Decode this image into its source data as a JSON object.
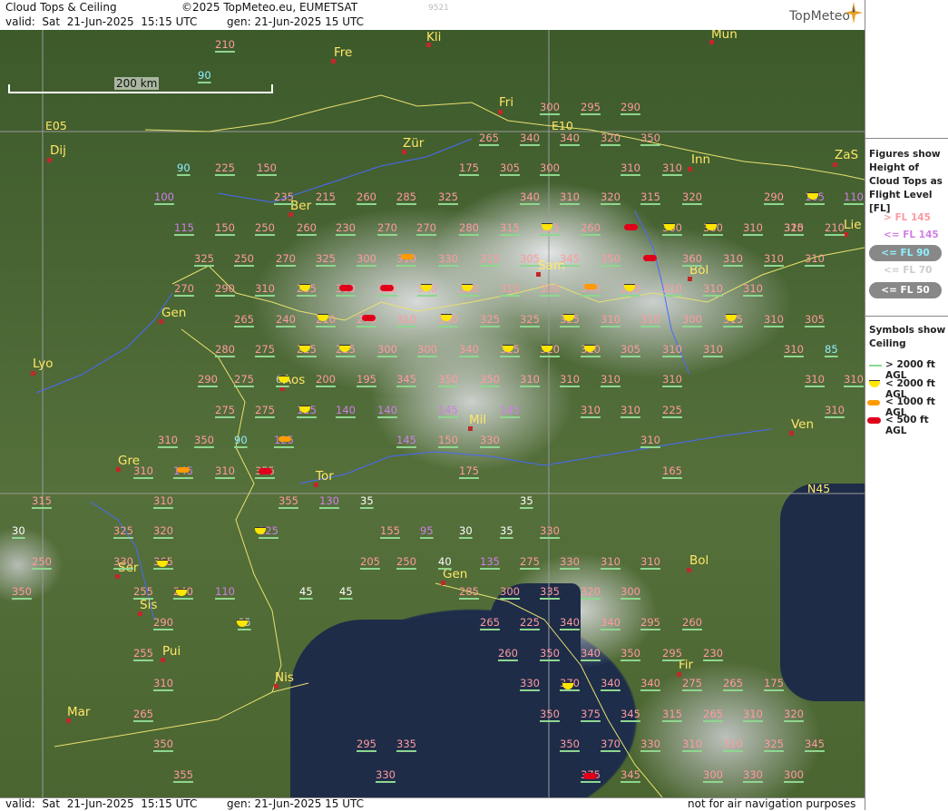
{
  "header": {
    "title": "Cloud Tops & Ceiling",
    "copyright": "©2025 TopMeteo.eu, EUMETSAT",
    "valid": "valid:  Sat  21-Jun-2025  15:15 UTC",
    "gen": "gen: 21-Jun-2025 15 UTC",
    "id": "9521",
    "logo": "TopMeteo"
  },
  "footer": {
    "valid": "valid:  Sat  21-Jun-2025  15:15 UTC",
    "gen": "gen: 21-Jun-2025 15 UTC",
    "disclaimer": "not for air navigation purposes"
  },
  "scale": {
    "label": "200 km"
  },
  "legend": {
    "figures_title": "Figures show Height of Cloud Tops as Flight Level  [FL]",
    "figures": [
      {
        "label": "> FL 145",
        "color": "#ff9aa0"
      },
      {
        "label": "<= FL 145",
        "color": "#d07ee8"
      },
      {
        "label": "<= FL 90",
        "color": "#8ff0ff"
      },
      {
        "label": "<= FL 70",
        "color": "#cccccc"
      },
      {
        "label": "<= FL 50",
        "color": "#ffffff"
      }
    ],
    "symbols_title": "Symbols show Ceiling",
    "symbols": [
      {
        "label": "> 2000 ft AGL",
        "color": "#8fd68f"
      },
      {
        "label": "< 2000 ft AGL",
        "color": "#ffe600"
      },
      {
        "label": "< 1000 ft AGL",
        "color": "#ff9a00"
      },
      {
        "label": "< 500 ft AGL",
        "color": "#e0001a"
      }
    ]
  },
  "cities": [
    {
      "name": "Fre"
    },
    {
      "name": "Kli"
    },
    {
      "name": "Mun"
    },
    {
      "name": "Dij"
    },
    {
      "name": "Zür"
    },
    {
      "name": "Fri"
    },
    {
      "name": "Inn"
    },
    {
      "name": "ZaS"
    },
    {
      "name": "Lie"
    },
    {
      "name": "Ber"
    },
    {
      "name": "Sam"
    },
    {
      "name": "Bol"
    },
    {
      "name": "Gen"
    },
    {
      "name": "Lyo"
    },
    {
      "name": "Aos"
    },
    {
      "name": "Mil"
    },
    {
      "name": "Ven"
    },
    {
      "name": "Gre"
    },
    {
      "name": "Tor"
    },
    {
      "name": "Ser"
    },
    {
      "name": "Gen"
    },
    {
      "name": "Bol"
    },
    {
      "name": "Sis"
    },
    {
      "name": "Pui"
    },
    {
      "name": "Nis"
    },
    {
      "name": "Fir"
    },
    {
      "name": "Mar"
    }
  ],
  "grid_labels": [
    "E05",
    "E10",
    "N45"
  ],
  "flight_levels": [
    "210",
    "90",
    "225",
    "150",
    "90",
    "100",
    "235",
    "215",
    "260",
    "285",
    "325",
    "175",
    "305",
    "300",
    "300",
    "295",
    "290",
    "265",
    "340",
    "340",
    "320",
    "350",
    "310",
    "310",
    "320",
    "315",
    "340",
    "310",
    "320",
    "290",
    "105",
    "110",
    "115",
    "150",
    "250",
    "260",
    "230",
    "270",
    "270",
    "280",
    "315",
    "325",
    "260",
    "360",
    "360",
    "310",
    "310",
    "210",
    "325",
    "325",
    "250",
    "270",
    "325",
    "300",
    "310",
    "330",
    "315",
    "305",
    "345",
    "350",
    "360",
    "310",
    "310",
    "310",
    "270",
    "290",
    "310",
    "255",
    "300",
    "325",
    "340",
    "350",
    "310",
    "310",
    "340",
    "260",
    "310",
    "310",
    "310",
    "265",
    "240",
    "210",
    "240",
    "310",
    "340",
    "325",
    "325",
    "325",
    "310",
    "310",
    "300",
    "315",
    "310",
    "305",
    "280",
    "275",
    "225",
    "225",
    "300",
    "300",
    "340",
    "325",
    "320",
    "310",
    "305",
    "310",
    "310",
    "310",
    "85",
    "290",
    "275",
    "60",
    "200",
    "195",
    "345",
    "350",
    "350",
    "310",
    "310",
    "310",
    "310",
    "310",
    "310",
    "275",
    "275",
    "125",
    "140",
    "140",
    "145",
    "145",
    "310",
    "310",
    "225",
    "310",
    "310",
    "350",
    "90",
    "125",
    "145",
    "150",
    "330",
    "310",
    "310",
    "310",
    "355",
    "145",
    "175",
    "165",
    "315",
    "310",
    "355",
    "130",
    "35",
    "35",
    "30",
    "325",
    "320",
    "125",
    "155",
    "95",
    "30",
    "35",
    "330",
    "250",
    "330",
    "365",
    "205",
    "250",
    "40",
    "135",
    "275",
    "330",
    "310",
    "310",
    "350",
    "255",
    "240",
    "110",
    "45",
    "45",
    "285",
    "300",
    "335",
    "320",
    "300",
    "290",
    "65",
    "265",
    "225",
    "340",
    "340",
    "295",
    "260",
    "255",
    "260",
    "350",
    "340",
    "350",
    "295",
    "230",
    "310",
    "330",
    "370",
    "340",
    "340",
    "275",
    "265",
    "175",
    "265",
    "350",
    "375",
    "345",
    "315",
    "265",
    "310",
    "320",
    "350",
    "295",
    "335",
    "350",
    "370",
    "330",
    "310",
    "310",
    "325",
    "345",
    "355",
    "330",
    "375",
    "345",
    "300",
    "330",
    "300"
  ]
}
